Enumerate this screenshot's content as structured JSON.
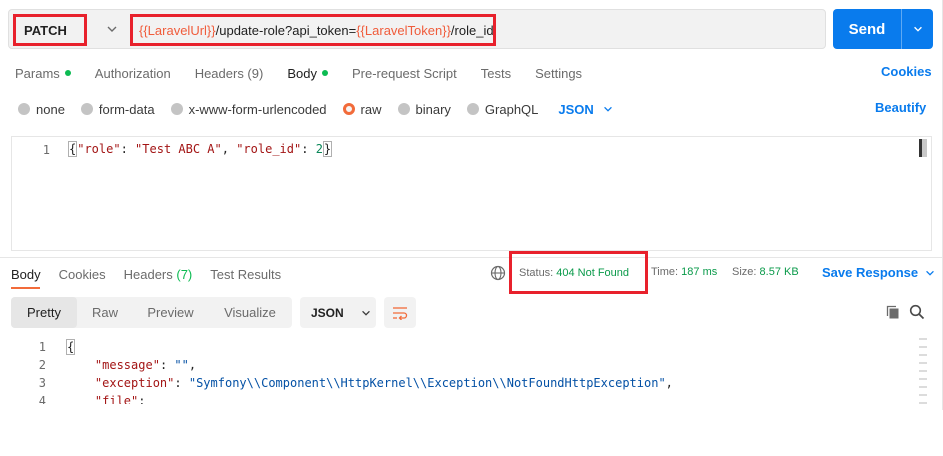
{
  "request": {
    "method": "PATCH",
    "url_parts": [
      {
        "text": "{{LaravelUrl}}",
        "type": "var"
      },
      {
        "text": "/update-role?api_token=",
        "type": "plain"
      },
      {
        "text": "{{LaravelToken}}",
        "type": "var"
      },
      {
        "text": "/role_id",
        "type": "plain"
      }
    ],
    "send_label": "Send"
  },
  "tabs": [
    {
      "label": "Params",
      "dot": true
    },
    {
      "label": "Authorization",
      "dot": false
    },
    {
      "label": "Headers (9)",
      "dot": false
    },
    {
      "label": "Body",
      "dot": true,
      "active": true
    },
    {
      "label": "Pre-request Script",
      "dot": false
    },
    {
      "label": "Tests",
      "dot": false
    },
    {
      "label": "Settings",
      "dot": false
    }
  ],
  "cookies_label": "Cookies",
  "body_types": [
    {
      "label": "none",
      "selected": false
    },
    {
      "label": "form-data",
      "selected": false
    },
    {
      "label": "x-www-form-urlencoded",
      "selected": false
    },
    {
      "label": "raw",
      "selected": true
    },
    {
      "label": "binary",
      "selected": false
    },
    {
      "label": "GraphQL",
      "selected": false
    }
  ],
  "body_format": "JSON",
  "beautify_label": "Beautify",
  "editor": {
    "line_number": "1",
    "tokens": [
      {
        "t": "{",
        "c": "brace"
      },
      {
        "t": "\"role\"",
        "c": "key"
      },
      {
        "t": ": ",
        "c": "p"
      },
      {
        "t": "\"Test ABC A\"",
        "c": "str"
      },
      {
        "t": ", ",
        "c": "p"
      },
      {
        "t": "\"role_id\"",
        "c": "key"
      },
      {
        "t": ": ",
        "c": "p"
      },
      {
        "t": "2",
        "c": "num"
      },
      {
        "t": "}",
        "c": "brace"
      }
    ]
  },
  "response": {
    "tabs": [
      {
        "label": "Body",
        "active": true
      },
      {
        "label": "Cookies"
      },
      {
        "label": "Headers",
        "count": "(7)"
      },
      {
        "label": "Test Results"
      }
    ],
    "status_label": "Status:",
    "status_value": "404 Not Found",
    "time_label": "Time:",
    "time_value": "187 ms",
    "size_label": "Size:",
    "size_value": "8.57 KB",
    "save_label": "Save Response",
    "views": [
      "Pretty",
      "Raw",
      "Preview",
      "Visualize"
    ],
    "active_view": "Pretty",
    "format": "JSON",
    "lines": [
      {
        "n": "1",
        "parts": [
          {
            "t": "{",
            "c": "p"
          }
        ]
      },
      {
        "n": "2",
        "parts": [
          {
            "t": "    ",
            "c": "p"
          },
          {
            "t": "\"message\"",
            "c": "k"
          },
          {
            "t": ": ",
            "c": "p"
          },
          {
            "t": "\"\"",
            "c": "s"
          },
          {
            "t": ",",
            "c": "p"
          }
        ]
      },
      {
        "n": "3",
        "parts": [
          {
            "t": "    ",
            "c": "p"
          },
          {
            "t": "\"exception\"",
            "c": "k"
          },
          {
            "t": ": ",
            "c": "p"
          },
          {
            "t": "\"Symfony\\\\Component\\\\HttpKernel\\\\Exception\\\\NotFoundHttpException\"",
            "c": "s"
          },
          {
            "t": ",",
            "c": "p"
          }
        ]
      },
      {
        "n": "4",
        "parts": [
          {
            "t": "    ",
            "c": "p"
          },
          {
            "t": "\"file\"",
            "c": "k"
          },
          {
            "t": ":",
            "c": "p"
          }
        ]
      }
    ]
  },
  "colors": {
    "accent": "#097bed",
    "highlight": "#e8212c",
    "success": "#0a9a4a",
    "orange": "#f26b3a"
  }
}
